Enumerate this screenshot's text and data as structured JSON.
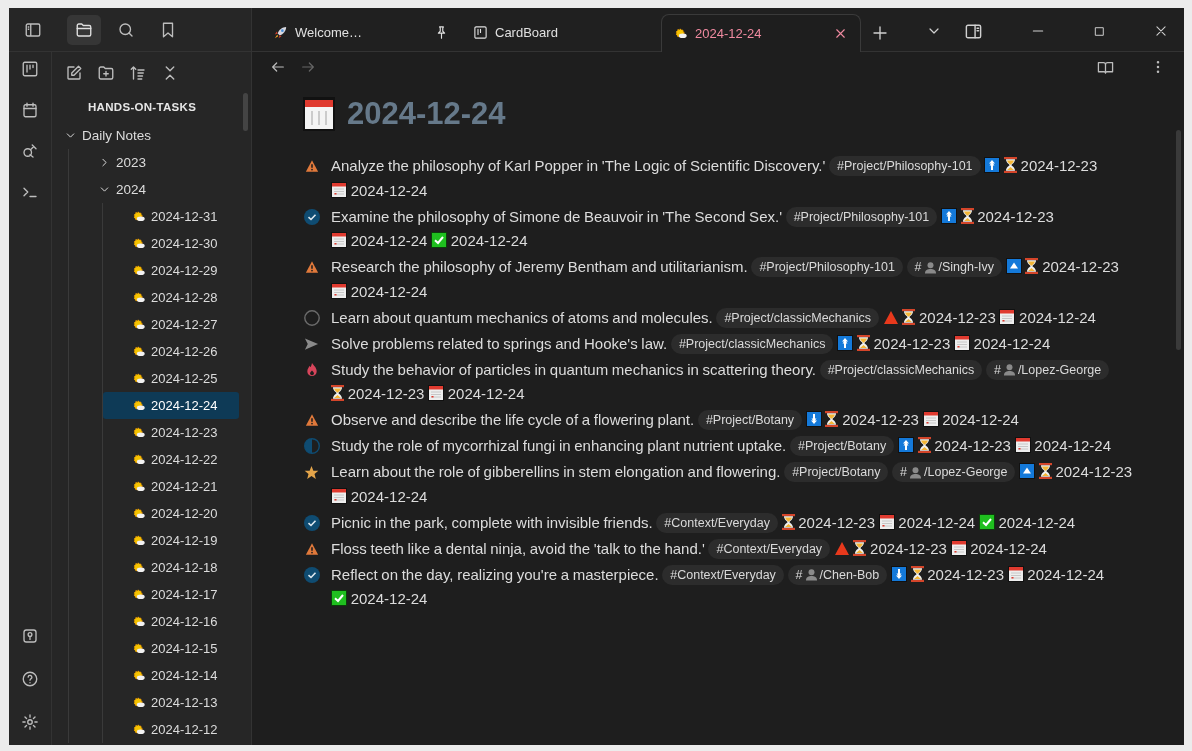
{
  "explorer_tabs": [
    {
      "kind": "files",
      "selected": true
    },
    {
      "kind": "search",
      "selected": false
    },
    {
      "kind": "bookmarks",
      "selected": false
    }
  ],
  "tabs": [
    {
      "label": "Welcome…",
      "pinned": true,
      "selected": false
    },
    {
      "label": "CardBoard",
      "pinned": false,
      "selected": false
    },
    {
      "label": "2024-12-24",
      "pinned": false,
      "selected": true
    }
  ],
  "vault": "HANDS-ON-TASKS",
  "tree": [
    {
      "label": "Daily Notes",
      "expanded": true,
      "children": [
        {
          "label": "2023",
          "expanded": false
        },
        {
          "label": "2024",
          "expanded": true,
          "children": [
            {
              "label": "2024-12-31",
              "selected": false
            },
            {
              "label": "2024-12-30",
              "selected": false
            },
            {
              "label": "2024-12-29",
              "selected": false
            },
            {
              "label": "2024-12-28",
              "selected": false
            },
            {
              "label": "2024-12-27",
              "selected": false
            },
            {
              "label": "2024-12-26",
              "selected": false
            },
            {
              "label": "2024-12-25",
              "selected": false
            },
            {
              "label": "2024-12-24",
              "selected": true
            },
            {
              "label": "2024-12-23",
              "selected": false
            },
            {
              "label": "2024-12-22",
              "selected": false
            },
            {
              "label": "2024-12-21",
              "selected": false
            },
            {
              "label": "2024-12-20",
              "selected": false
            },
            {
              "label": "2024-12-19",
              "selected": false
            },
            {
              "label": "2024-12-18",
              "selected": false
            },
            {
              "label": "2024-12-17",
              "selected": false
            },
            {
              "label": "2024-12-16",
              "selected": false
            },
            {
              "label": "2024-12-15",
              "selected": false
            },
            {
              "label": "2024-12-14",
              "selected": false
            },
            {
              "label": "2024-12-13",
              "selected": false
            },
            {
              "label": "2024-12-12",
              "selected": false
            }
          ]
        }
      ]
    }
  ],
  "note": {
    "title": "2024-12-24",
    "tasks": [
      {
        "status": {
          "kind": "warning"
        },
        "text": "Analyze the philosophy of Karl Popper in 'The Logic of Scientific Discovery.'",
        "tags": [
          {
            "kind": "tag",
            "text": "#Project/Philosophy-101"
          }
        ],
        "priority": {
          "kind": "high"
        },
        "scheduled": "2024-12-23",
        "due": "2024-12-24"
      },
      {
        "status": {
          "kind": "done"
        },
        "text": "Examine the philosophy of Simone de Beauvoir in 'The Second Sex.'",
        "tags": [
          {
            "kind": "tag",
            "text": "#Project/Philosophy-101"
          }
        ],
        "priority": {
          "kind": "high"
        },
        "scheduled": "2024-12-23",
        "due": "2024-12-24",
        "done": "2024-12-24"
      },
      {
        "status": {
          "kind": "warning"
        },
        "text": "Research the philosophy of Jeremy Bentham and utilitarianism.",
        "tags": [
          {
            "kind": "tag",
            "text": "#Project/Philosophy-101"
          },
          {
            "kind": "person",
            "prefix": "#",
            "text": "/Singh-Ivy"
          }
        ],
        "priority": {
          "kind": "medium"
        },
        "scheduled": "2024-12-23",
        "due": "2024-12-24"
      },
      {
        "status": {
          "kind": "open"
        },
        "text": "Learn about quantum mechanics of atoms and molecules.",
        "tags": [
          {
            "kind": "tag",
            "text": "#Project/classicMechanics"
          }
        ],
        "priority": {
          "kind": "highest"
        },
        "scheduled": "2024-12-23",
        "due": "2024-12-24"
      },
      {
        "status": {
          "kind": "forwarded"
        },
        "text": "Solve problems related to springs and Hooke's law.",
        "tags": [
          {
            "kind": "tag",
            "text": "#Project/classicMechanics"
          }
        ],
        "priority": {
          "kind": "high"
        },
        "scheduled": "2024-12-23",
        "due": "2024-12-24"
      },
      {
        "status": {
          "kind": "important"
        },
        "text": "Study the behavior of particles in quantum mechanics in scattering theory.",
        "tags": [
          {
            "kind": "tag",
            "text": "#Project/classicMechanics"
          },
          {
            "kind": "person",
            "prefix": "#",
            "text": "/Lopez-George"
          }
        ],
        "scheduled": "2024-12-23",
        "due": "2024-12-24"
      },
      {
        "status": {
          "kind": "warning"
        },
        "text": "Observe and describe the life cycle of a flowering plant.",
        "tags": [
          {
            "kind": "tag",
            "text": "#Project/Botany"
          }
        ],
        "priority": {
          "kind": "low"
        },
        "scheduled": "2024-12-23",
        "due": "2024-12-24"
      },
      {
        "status": {
          "kind": "half"
        },
        "text": "Study the role of mycorrhizal fungi in enhancing plant nutrient uptake.",
        "tags": [
          {
            "kind": "tag",
            "text": "#Project/Botany"
          }
        ],
        "priority": {
          "kind": "high"
        },
        "scheduled": "2024-12-23",
        "due": "2024-12-24"
      },
      {
        "status": {
          "kind": "star"
        },
        "text": "Learn about the role of gibberellins in stem elongation and flowering.",
        "tags": [
          {
            "kind": "tag",
            "text": "#Project/Botany"
          },
          {
            "kind": "person",
            "prefix": "#",
            "text": "/Lopez-George"
          }
        ],
        "priority": {
          "kind": "medium"
        },
        "scheduled": "2024-12-23",
        "due": "2024-12-24"
      },
      {
        "status": {
          "kind": "done"
        },
        "text": "Picnic in the park, complete with invisible friends.",
        "tags": [
          {
            "kind": "tag",
            "text": "#Context/Everyday"
          }
        ],
        "scheduled": "2024-12-23",
        "due": "2024-12-24",
        "done": "2024-12-24"
      },
      {
        "status": {
          "kind": "warning"
        },
        "text": "Floss teeth like a dental ninja, avoid the 'talk to the hand.'",
        "tags": [
          {
            "kind": "tag",
            "text": "#Context/Everyday"
          }
        ],
        "priority": {
          "kind": "highest"
        },
        "scheduled": "2024-12-23",
        "due": "2024-12-24"
      },
      {
        "status": {
          "kind": "done"
        },
        "text": "Reflect on the day, realizing you're a masterpiece.",
        "tags": [
          {
            "kind": "tag",
            "text": "#Context/Everyday"
          },
          {
            "kind": "person",
            "prefix": "#",
            "text": "/Chen-Bob"
          }
        ],
        "priority": {
          "kind": "low"
        },
        "scheduled": "2024-12-23",
        "due": "2024-12-24",
        "done": "2024-12-24"
      }
    ]
  }
}
